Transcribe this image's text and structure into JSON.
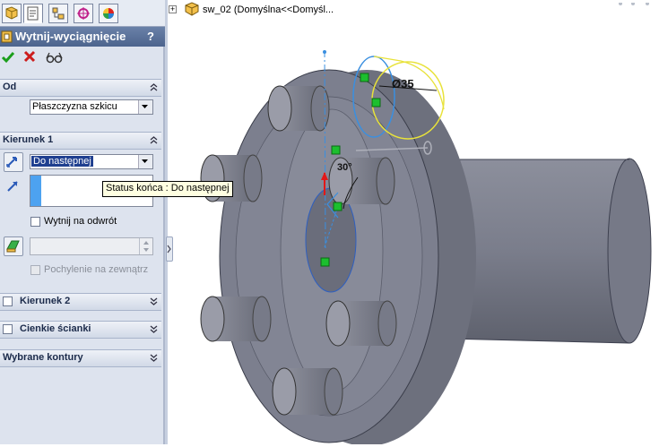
{
  "tree": {
    "expander": "+",
    "part_label": "sw_02  (Domyślna<<Domyśl..."
  },
  "panel": {
    "title": "Wytnij-wyciągnięcie",
    "help": "?",
    "tabs": [
      "feature-manager-icon",
      "property-manager-icon",
      "configuration-manager-icon",
      "dimxpert-icon",
      "display-manager-icon"
    ],
    "actions": {
      "ok": "ok-checkmark-icon",
      "cancel": "cancel-x-icon",
      "preview": "preview-glasses-icon"
    },
    "from_group": {
      "header": "Od",
      "selected": "Płaszczyzna szkicu"
    },
    "direction1": {
      "header": "Kierunek 1",
      "end_condition": "Do następnej",
      "flip_side_label": "Wytnij na odwrót",
      "draft_outward_label": "Pochylenie na zewnątrz"
    },
    "direction2": {
      "header": "Kierunek 2"
    },
    "thin_feature": {
      "header": "Cienkie ścianki"
    },
    "selected_contours": {
      "header": "Wybrane kontury"
    }
  },
  "tooltip": {
    "text": "Status końca : Do następnej"
  },
  "viewport": {
    "dimension_diameter": "Ø35",
    "dimension_angle": "30°"
  },
  "colors": {
    "title_bar": "#4c648d",
    "panel_bg": "#dde3ee",
    "part_gray": "#7c7f8e",
    "sketch_blue": "#3a8fe0",
    "preview_yellow": "#e8e23a",
    "accept_green": "#1b9e1b",
    "cancel_red": "#cc1c1c"
  }
}
